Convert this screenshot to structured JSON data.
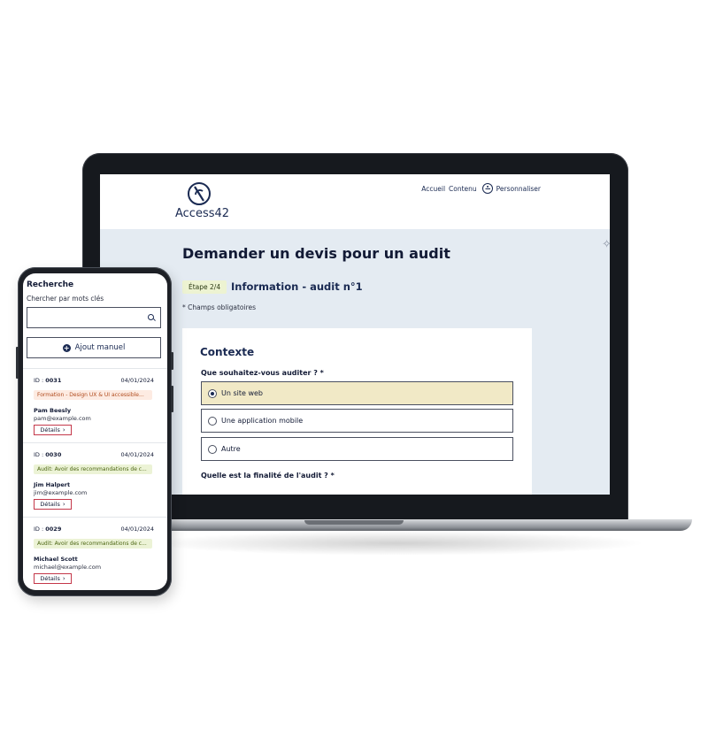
{
  "laptop": {
    "site": {
      "logo_text": "Access42",
      "nav": [
        "Accueil",
        "Contenu",
        "Personnaliser"
      ]
    },
    "page_title": "Demander un devis pour un audit",
    "step_badge": "Étape 2/4",
    "step_title": "Information - audit n°1",
    "required_note": "* Champs obligatoires",
    "form": {
      "heading": "Contexte",
      "question1": "Que souhaitez-vous auditer ? *",
      "options": [
        {
          "label": "Un site web",
          "selected": true
        },
        {
          "label": "Une application mobile",
          "selected": false
        },
        {
          "label": "Autre",
          "selected": false
        }
      ],
      "question2": "Quelle est la finalité de l'audit ? *"
    }
  },
  "phone": {
    "title": "Recherche",
    "search_label": "Chercher par mots clés",
    "add_button": "Ajout manuel",
    "cards": [
      {
        "id_label": "ID :",
        "id": "0031",
        "date": "04/01/2024",
        "tag": "Formation - Design UX & UI accessible...",
        "tag_color": "orange",
        "name": "Pam Beesly",
        "email": "pam@example.com",
        "details": "Détails"
      },
      {
        "id_label": "ID :",
        "id": "0030",
        "date": "04/01/2024",
        "tag": "Audit: Avoir des recommandations de c...",
        "tag_color": "green",
        "name": "Jim Halpert",
        "email": "jim@example.com",
        "details": "Détails"
      },
      {
        "id_label": "ID :",
        "id": "0029",
        "date": "04/01/2024",
        "tag": "Audit: Avoir des recommandations de c...",
        "tag_color": "green",
        "name": "Michael Scott",
        "email": "michael@example.com",
        "details": "Détails"
      }
    ]
  },
  "colors": {
    "brand_navy": "#1a2a52",
    "selected_option": "#f1e9c6",
    "page_bg": "#e4ebf2",
    "detail_border": "#c4384a"
  }
}
